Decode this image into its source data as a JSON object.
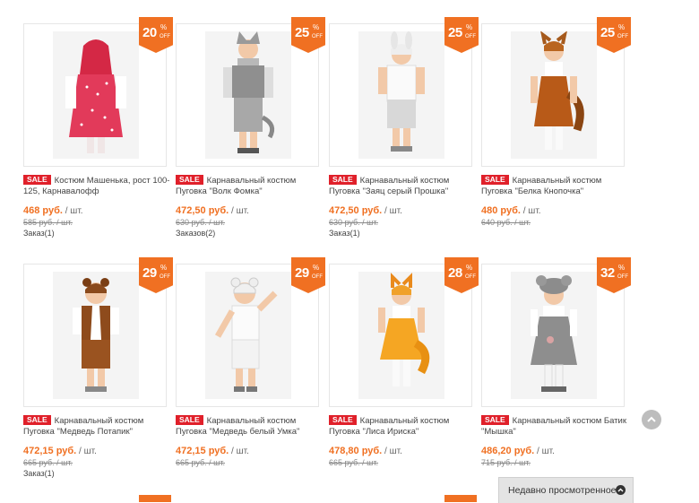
{
  "colors": {
    "accent": "#f07022",
    "sale": "#e0202a",
    "border": "#e6e6e6"
  },
  "badge_units": {
    "percent": "%",
    "off": "OFF"
  },
  "products": [
    {
      "discount": "20",
      "sale": "SALE",
      "title": "Костюм Машенька, рост 100-125, Карнавалофф",
      "price": "468 руб.",
      "unit": "/ шт.",
      "old_price": "585 руб. / шт.",
      "orders": "Заказ(1)",
      "figure": "girl-polka-dress"
    },
    {
      "discount": "25",
      "sale": "SALE",
      "title": "Карнавальный костюм Пуговка \"Волк Фомка\"",
      "price": "472,50 руб.",
      "unit": "/ шт.",
      "old_price": "630 руб. / шт.",
      "orders": "Заказов(2)",
      "figure": "boy-wolf"
    },
    {
      "discount": "25",
      "sale": "SALE",
      "title": "Карнавальный костюм Пуговка \"Заяц серый Прошка\"",
      "price": "472,50 руб.",
      "unit": "/ шт.",
      "old_price": "630 руб. / шт.",
      "orders": "Заказ(1)",
      "figure": "boy-hare"
    },
    {
      "discount": "25",
      "sale": "SALE",
      "title": "Карнавальный костюм Пуговка \"Белка Кнопочка\"",
      "price": "480 руб.",
      "unit": "/ шт.",
      "old_price": "640 руб. / шт.",
      "orders": "",
      "figure": "girl-squirrel"
    },
    {
      "discount": "29",
      "sale": "SALE",
      "title": "Карнавальный костюм Пуговка \"Медведь Потапик\"",
      "price": "472,15 руб.",
      "unit": "/ шт.",
      "old_price": "665 руб. / шт.",
      "orders": "Заказ(1)",
      "figure": "boy-bear"
    },
    {
      "discount": "29",
      "sale": "SALE",
      "title": "Карнавальный костюм Пуговка \"Медведь белый Умка\"",
      "price": "472,15 руб.",
      "unit": "/ шт.",
      "old_price": "665 руб. / шт.",
      "orders": "",
      "figure": "boy-polar-bear"
    },
    {
      "discount": "28",
      "sale": "SALE",
      "title": "Карнавальный костюм Пуговка \"Лиса Ириска\"",
      "price": "478,80 руб.",
      "unit": "/ шт.",
      "old_price": "665 руб. / шт.",
      "orders": "",
      "figure": "girl-fox"
    },
    {
      "discount": "32",
      "sale": "SALE",
      "title": "Карнавальный костюм Батик \"Мышка\"",
      "price": "486,20 руб.",
      "unit": "/ шт.",
      "old_price": "715 руб. / шт.",
      "orders": "",
      "figure": "girl-mouse"
    }
  ],
  "scroll_top": {
    "icon": "chevron-up-icon"
  },
  "recently_viewed": {
    "label": "Недавно просмотренное",
    "icon": "chevron-up-icon"
  }
}
